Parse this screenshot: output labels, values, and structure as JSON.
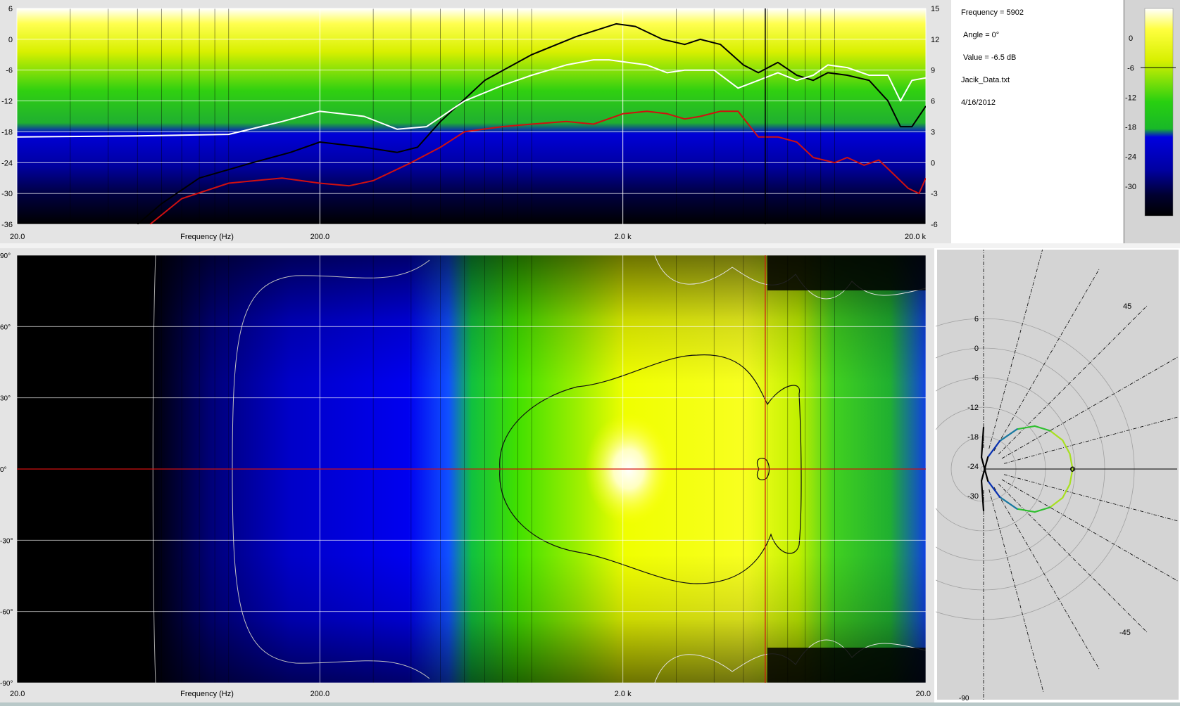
{
  "info": {
    "frequency": "Frequency = 5902",
    "angle": "Angle = 0°",
    "value": "Value = -6.5 dB",
    "file": "Jacik_Data.txt",
    "date": "4/16/2012"
  },
  "colors": {
    "red_curve": "#d01010",
    "black_curve": "#000000",
    "white_curve": "#ffffff",
    "cursor": "#d01010",
    "panel_bg": "#d4d4d4"
  },
  "chart_data": [
    {
      "type": "line",
      "name": "frequency-response",
      "xscale": "log",
      "xlim": [
        20,
        20000
      ],
      "xlabel": "Frequency (Hz)",
      "x_tick_labels": [
        "20.0",
        "200.0",
        "2.0 k",
        "20.0 k"
      ],
      "x_tick_values": [
        20,
        200,
        2000,
        20000
      ],
      "ylim_left": [
        -36,
        6
      ],
      "y_ticks_left": [
        6,
        0,
        -6,
        -12,
        -18,
        -24,
        -30,
        -36
      ],
      "ylim_right": [
        -6,
        15
      ],
      "y_ticks_right": [
        15,
        12,
        9,
        6,
        3,
        0,
        -3,
        -6
      ],
      "background": "colormap gradient (dB)",
      "cursor_x": 5902,
      "series": [
        {
          "color": "black",
          "x": [
            50,
            60,
            80,
            120,
            160,
            200,
            280,
            360,
            420,
            500,
            700,
            1000,
            1400,
            1900,
            2200,
            2700,
            3200,
            3600,
            4200,
            5000,
            5600,
            6500,
            7500,
            8500,
            9500,
            11000,
            13000,
            15000,
            16500,
            18000,
            20000
          ],
          "y": [
            -36,
            -32,
            -27,
            -24,
            -22,
            -20,
            -21,
            -22,
            -21,
            -16,
            -8,
            -3,
            0.5,
            3,
            2.5,
            0,
            -1,
            0,
            -1,
            -5,
            -6.5,
            -4.5,
            -7,
            -8,
            -6.5,
            -7,
            -8,
            -12,
            -17,
            -17,
            -13
          ]
        },
        {
          "color": "white",
          "x": [
            20,
            50,
            100,
            150,
            200,
            280,
            360,
            450,
            600,
            800,
            1000,
            1300,
            1600,
            1800,
            2400,
            2800,
            3200,
            4000,
            4800,
            5600,
            6500,
            7500,
            8500,
            9500,
            11000,
            13000,
            15000,
            16500,
            18000,
            20000
          ],
          "y": [
            -19,
            -18.8,
            -18.5,
            -16,
            -14,
            -15,
            -17.5,
            -17,
            -12,
            -9,
            -7,
            -5,
            -4,
            -4,
            -5,
            -6.5,
            -6,
            -6,
            -9.5,
            -8,
            -6.5,
            -8,
            -7,
            -5,
            -5.5,
            -7,
            -7,
            -12,
            -8,
            -7.5
          ]
        },
        {
          "color": "red",
          "x": [
            55,
            70,
            100,
            150,
            200,
            250,
            300,
            400,
            500,
            600,
            800,
            1000,
            1300,
            1600,
            2000,
            2400,
            2800,
            3200,
            3600,
            4200,
            4800,
            5600,
            6500,
            7500,
            8500,
            10000,
            11000,
            12500,
            14000,
            15500,
            17500,
            19000,
            20000
          ],
          "y": [
            -36,
            -31,
            -28,
            -27,
            -28,
            -28.5,
            -27.5,
            -24,
            -21,
            -18,
            -17,
            -16.5,
            -16,
            -16.5,
            -14.5,
            -14,
            -14.5,
            -15.5,
            -15,
            -14,
            -14,
            -19,
            -19,
            -20,
            -23,
            -24,
            -23,
            -24.5,
            -23.5,
            -26,
            -29,
            -30,
            -27
          ]
        }
      ]
    },
    {
      "type": "heatmap",
      "name": "directivity-map",
      "xscale": "log",
      "xlim": [
        20,
        20000
      ],
      "xlabel": "Frequency (Hz)",
      "x_tick_labels": [
        "20.0",
        "200.0",
        "2.0 k",
        "20.0"
      ],
      "x_tick_values": [
        20,
        200,
        2000,
        20000
      ],
      "ylim": [
        -90,
        90
      ],
      "y_tick_labels": [
        "90°",
        "60°",
        "30°",
        "0°",
        "-30°",
        "-60°",
        "-90°"
      ],
      "y_tick_values": [
        90,
        60,
        30,
        0,
        -30,
        -60,
        -90
      ],
      "cursor_x": 5902,
      "cursor_y": 0
    },
    {
      "type": "scatter",
      "name": "colormap-scale",
      "ticks": [
        0,
        -6,
        -12,
        -18,
        -24,
        -30
      ],
      "marker": -6,
      "stops": [
        "#ffffff",
        "#ffff40",
        "#d8f000",
        "#28d010",
        "#18b828",
        "#0000e0",
        "#0000a0",
        "#000030",
        "#000000"
      ]
    },
    {
      "type": "line",
      "name": "polar-plot",
      "r_tick_labels": [
        "6",
        "0",
        "-6",
        "-12",
        "-18",
        "-24",
        "-30"
      ],
      "r_tick_values": [
        6,
        0,
        -6,
        -12,
        -18,
        -24,
        -30
      ],
      "angle_labels": [
        "45",
        "-45",
        "-90"
      ],
      "center_label": "0",
      "angles": [
        0,
        10,
        20,
        30,
        40,
        50,
        60,
        70,
        80,
        90
      ],
      "values_db": [
        -6.5,
        -6.8,
        -7.5,
        -9,
        -11,
        -14,
        -18,
        -22,
        -27,
        -33
      ]
    }
  ]
}
